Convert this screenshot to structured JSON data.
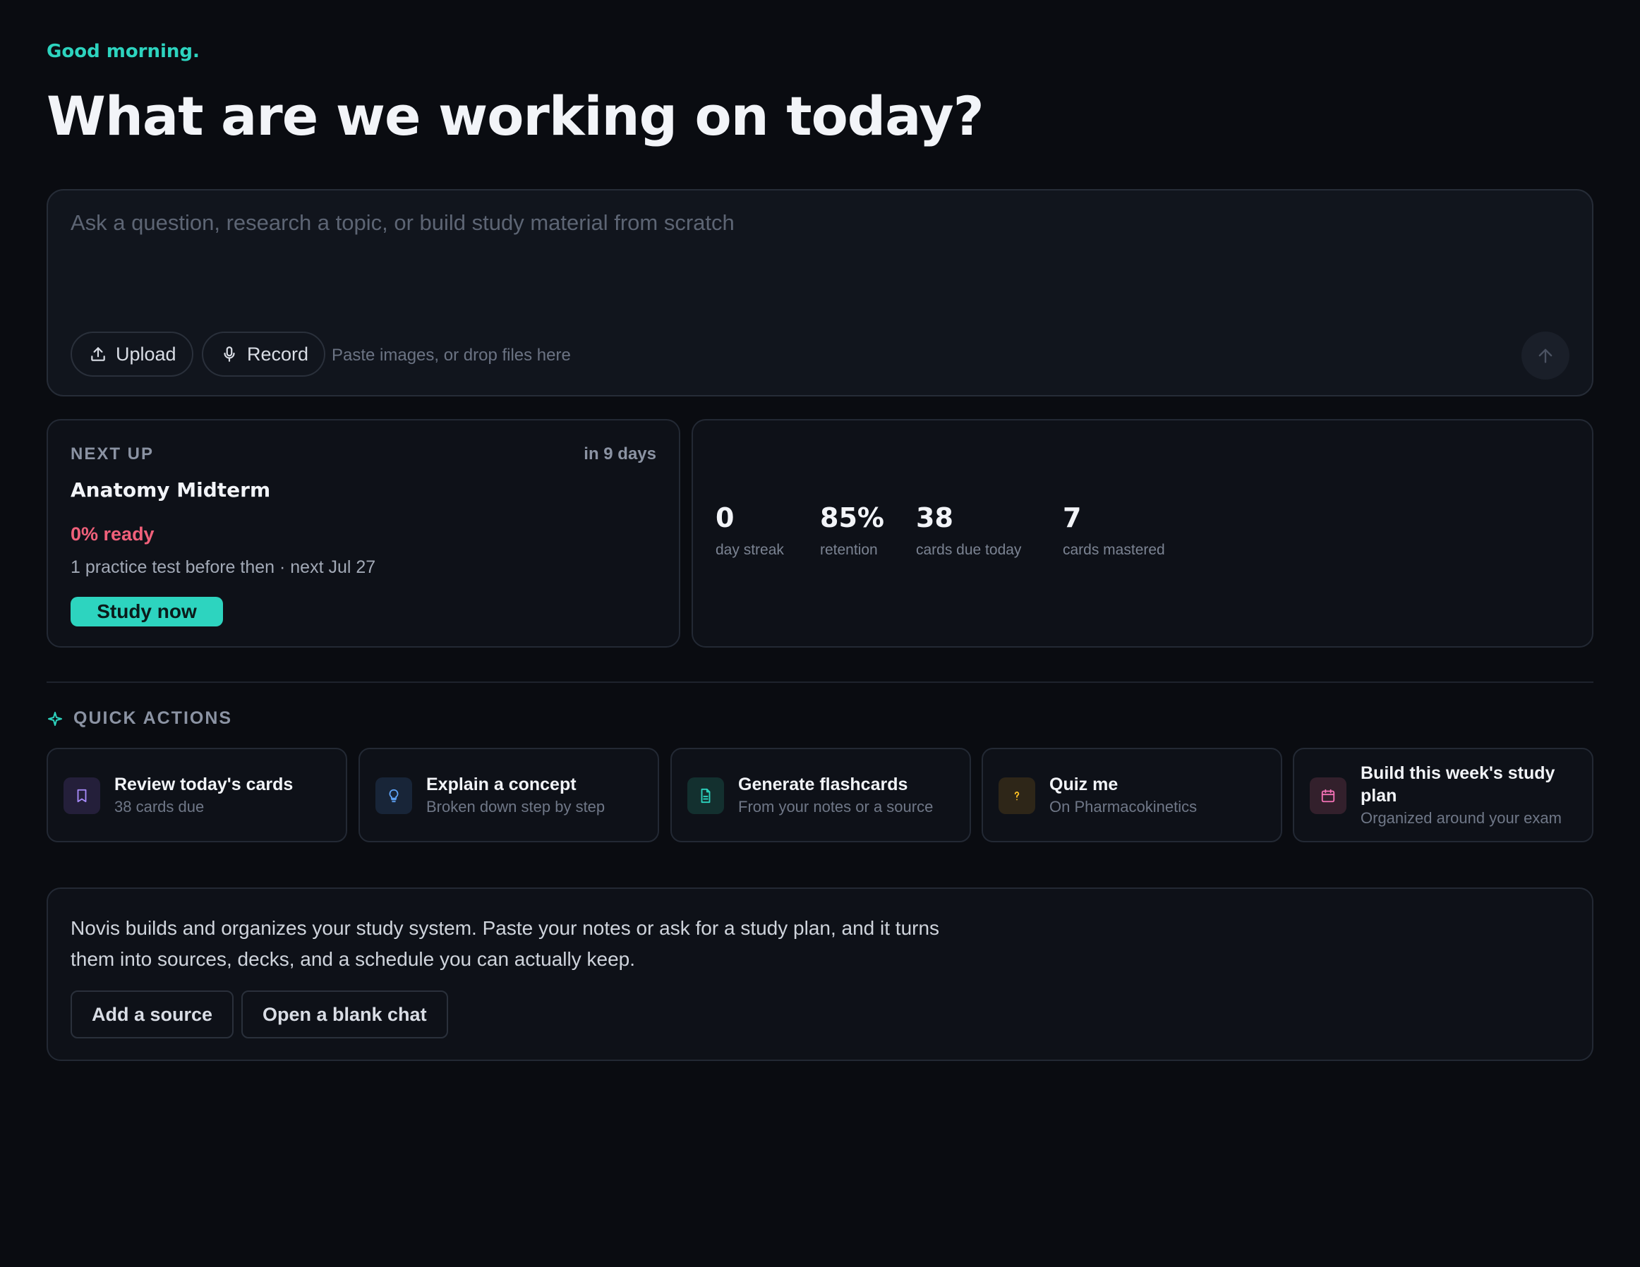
{
  "greeting": "Good morning.",
  "headline": "What are we working on today?",
  "composer": {
    "placeholder": "Ask a question, research a topic, or build study material from scratch",
    "upload_label": "Upload",
    "record_label": "Record",
    "drop_hint": "Paste images, or drop files here"
  },
  "next_up": {
    "eyebrow": "NEXT UP",
    "when": "in 9 days",
    "exam": "Anatomy Midterm",
    "ready": "0% ready",
    "detail": "1 practice test before then · next Jul 27",
    "cta": "Study now"
  },
  "stats": [
    {
      "value": "0",
      "label": "day streak"
    },
    {
      "value": "85%",
      "label": "retention"
    },
    {
      "value": "38",
      "label": "cards due today"
    },
    {
      "value": "7",
      "label": "cards mastered"
    }
  ],
  "quick_actions": {
    "title": "QUICK ACTIONS",
    "items": [
      {
        "title": "Review today's cards",
        "subtitle": "38 cards due",
        "icon": "bookmark-icon",
        "color": "#a78bfa",
        "bg": "#241f3a"
      },
      {
        "title": "Explain a concept",
        "subtitle": "Broken down step by step",
        "icon": "lightbulb-icon",
        "color": "#60a5fa",
        "bg": "#182538"
      },
      {
        "title": "Generate flashcards",
        "subtitle": "From your notes or a source",
        "icon": "document-icon",
        "color": "#2dd4bf",
        "bg": "#13302f"
      },
      {
        "title": "Quiz me",
        "subtitle": "On Pharmacokinetics",
        "icon": "question-icon",
        "color": "#fbbf24",
        "bg": "#2e2618"
      },
      {
        "title": "Build this week's study plan",
        "subtitle": "Organized around your exam",
        "icon": "calendar-icon",
        "color": "#f472b6",
        "bg": "#33202c"
      }
    ]
  },
  "info": {
    "body": "Novis builds and organizes your study system. Paste your notes or ask for a study plan, and it turns them into sources, decks, and a schedule you can actually keep.",
    "add_source": "Add a source",
    "blank_chat": "Open a blank chat"
  },
  "colors": {
    "accent": "#2dd4bf",
    "danger": "#f0607a",
    "background": "#0a0c11"
  }
}
